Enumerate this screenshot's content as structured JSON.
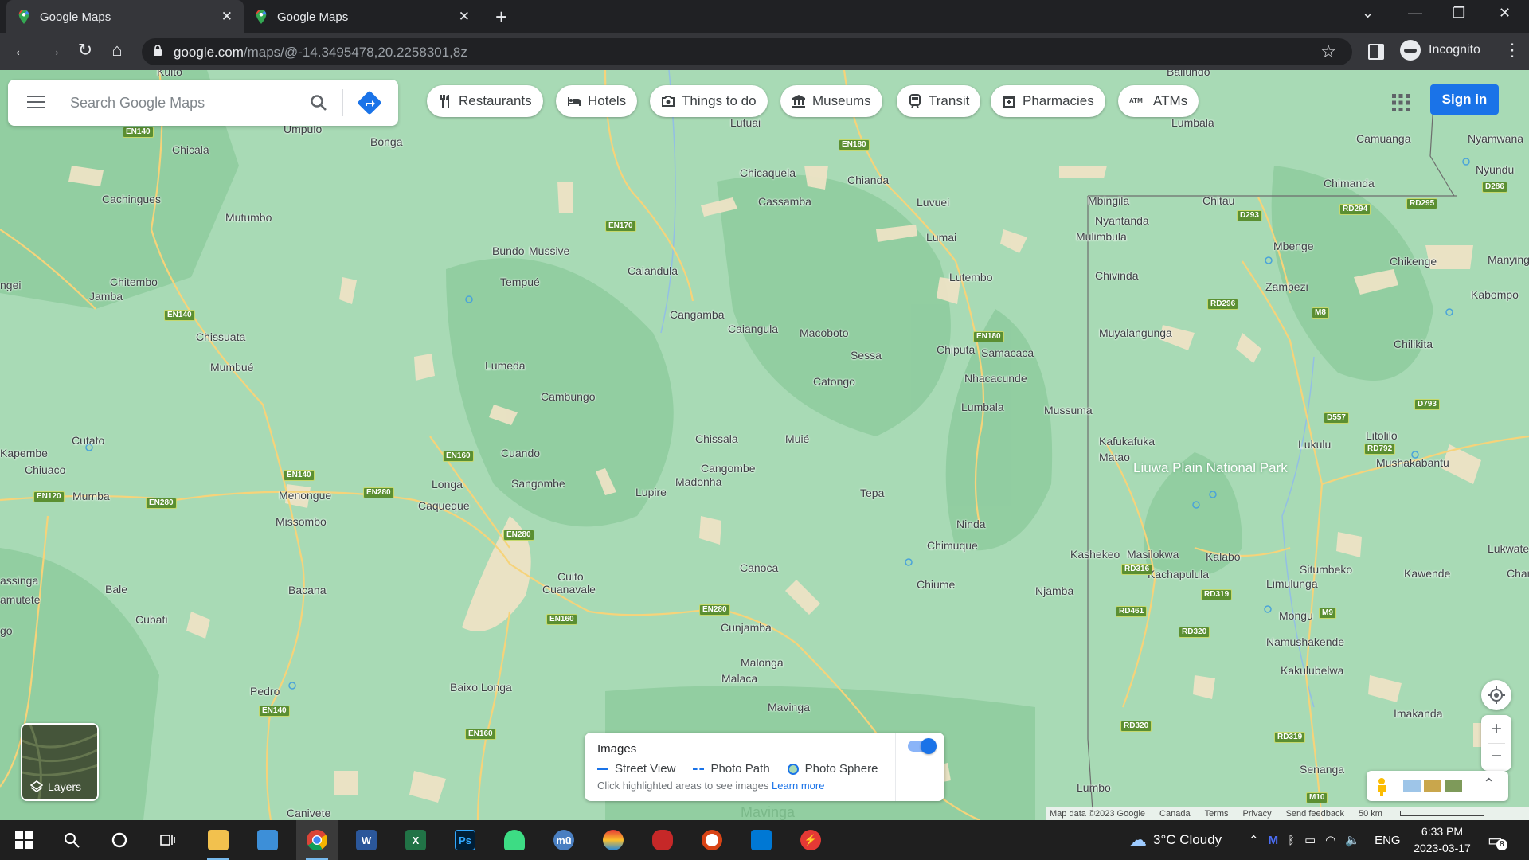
{
  "browser": {
    "tabs": [
      {
        "title": "Google Maps",
        "active": true
      },
      {
        "title": "Google Maps",
        "active": false
      }
    ],
    "url_host": "google.com",
    "url_path": "/maps/@-14.3495478,20.2258301,8z",
    "profile_label": "Incognito"
  },
  "search": {
    "placeholder": "Search Google Maps"
  },
  "categories": [
    {
      "label": "Restaurants",
      "icon": "fork-knife-icon"
    },
    {
      "label": "Hotels",
      "icon": "bed-icon"
    },
    {
      "label": "Things to do",
      "icon": "camera-icon"
    },
    {
      "label": "Museums",
      "icon": "museum-icon"
    },
    {
      "label": "Transit",
      "icon": "train-icon"
    },
    {
      "label": "Pharmacies",
      "icon": "pharmacy-icon"
    },
    {
      "label": "ATMs",
      "icon": "atm-icon"
    }
  ],
  "header": {
    "signin_label": "Sign in"
  },
  "layers": {
    "label": "Layers"
  },
  "images_legend": {
    "title": "Images",
    "street_view": "Street View",
    "photo_path": "Photo Path",
    "photo_sphere": "Photo Sphere",
    "hint": "Click highlighted areas to see images",
    "learn_more": "Learn more",
    "toggle_on": true
  },
  "map_footer": {
    "data": "Map data ©2023 Google",
    "region": "Canada",
    "terms": "Terms",
    "privacy": "Privacy",
    "feedback": "Send feedback",
    "scale": "50 km"
  },
  "map_places": [
    "Kuito",
    "Umpulo",
    "Bonga",
    "Chicala",
    "Cachingues",
    "Mutumbo",
    "Chitembo",
    "Jamba",
    "ngei",
    "Chissuata",
    "Mumbué",
    "Bundo",
    "Mussive",
    "Tempué",
    "Lumeda",
    "Cambungo",
    "Caiandula",
    "Cangamba",
    "Caiangula",
    "Macoboto",
    "Chicaquela",
    "Cassamba",
    "Chianda",
    "Luvuei",
    "Lumai",
    "Lutembo",
    "Lutuai",
    "Chiputa",
    "Samacaca",
    "Sessa",
    "Catongo",
    "Nhacacunde",
    "Lumbala",
    "Mussuma",
    "Chissala",
    "Muié",
    "Cangombe",
    "Madonha",
    "Lupire",
    "Tepa",
    "Cuando",
    "Sangombe",
    "Longa",
    "Caqueque",
    "Menongue",
    "Missombo",
    "Cutato",
    "Chiuaco",
    "Kapembe",
    "Mumba",
    "Bale",
    "Bacana",
    "Cubati",
    "assinga",
    "amutete",
    "go",
    "Cuito",
    "Cuanavale",
    "Canoca",
    "Cunjamba",
    "Malonga",
    "Malaca",
    "Mavinga",
    "Baixo Longa",
    "Pedro",
    "Canivete",
    "Ninda",
    "Chimuque",
    "Chiume",
    "Njamba",
    "Lumbo",
    "Mbingila",
    "Chitau",
    "Nyantanda",
    "Mulimbula",
    "Chivinda",
    "Muyalangunga",
    "Kafukafuka",
    "Matao",
    "Kashekeo",
    "Masilokwa",
    "Kalabo",
    "Kachapulula",
    "Mbenge",
    "Zambezi",
    "Chikenge",
    "Chilikita",
    "Lukulu",
    "Litolilo",
    "Mushakabantu",
    "Situmbeko",
    "Limulunga",
    "Mongu",
    "Namushakende",
    "Kakulubelwa",
    "Imakanda",
    "Senanga",
    "Kawende",
    "Lukwate",
    "Cham",
    "Camuanga",
    "Nyamwana",
    "Nyundu",
    "Chimanda",
    "Manyinga",
    "Kabompo",
    "Lumbala",
    "Bailundo",
    "Chiputa"
  ],
  "park_name": "Liuwa Plain National Park",
  "taskbar": {
    "weather": "3°C  Cloudy",
    "lang": "ENG",
    "time": "6:33 PM",
    "date": "2023-03-17",
    "notifications": "8"
  },
  "colors": {
    "map_green": "#a8dab5",
    "accent": "#1a73e8"
  }
}
